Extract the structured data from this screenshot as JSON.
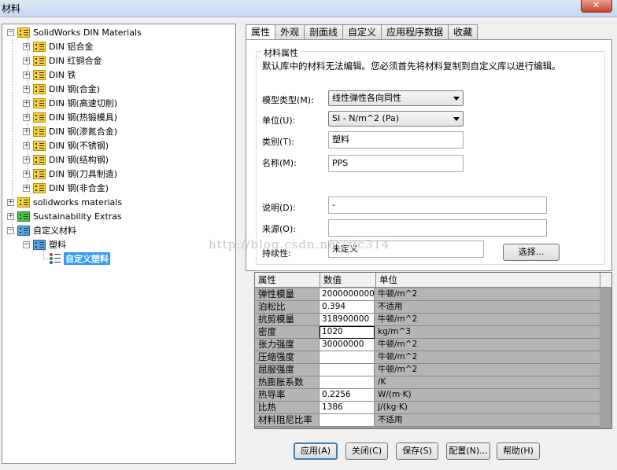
{
  "window": {
    "title": "材料"
  },
  "tree": {
    "libraries": [
      {
        "label": "SolidWorks DIN Materials",
        "expander": "−",
        "icon": "yellow-library-icon"
      },
      {
        "label": "solidworks materials",
        "expander": "+",
        "icon": "yellow-library-icon"
      },
      {
        "label": "Sustainability Extras",
        "expander": "+",
        "icon": "green-library-icon"
      },
      {
        "label": "自定义材料",
        "expander": "−",
        "icon": "blue-library-icon"
      }
    ],
    "din_categories": [
      "DIN 铝合金",
      "DIN 红铜合金",
      "DIN 铁",
      "DIN 钢(合金)",
      "DIN 钢(高速切削)",
      "DIN 钢(热锻模具)",
      "DIN 钢(渗氮合金)",
      "DIN 钢(不锈钢)",
      "DIN 钢(结构钢)",
      "DIN 钢(刀具制造)",
      "DIN 钢(非合金)"
    ],
    "custom_category": {
      "label": "塑料",
      "expander": "−"
    },
    "custom_material": {
      "label": "自定义塑料"
    }
  },
  "tabs": [
    "属性",
    "外观",
    "剖面线",
    "自定义",
    "应用程序数据",
    "收藏"
  ],
  "properties": {
    "group_title": "材料属性",
    "group_desc": "默认库中的材料无法编辑。您必须首先将材料复制到自定义库以进行编辑。",
    "model_type_label": "模型类型(M):",
    "model_type_value": "线性弹性各向同性",
    "units_label": "单位(U):",
    "units_value": "SI - N/m^2 (Pa)",
    "category_label": "类别(T):",
    "category_value": "塑料",
    "name_label": "名称(M):",
    "name_value": "PPS",
    "description_label": "说明(D):",
    "description_value": "-",
    "source_label": "来源(O):",
    "source_value": "",
    "sustainability_label": "持续性:",
    "sustainability_value": "未定义",
    "select_button": "选择..."
  },
  "watermark": "http://blog.csdn.net/zjc314",
  "grid": {
    "headers": [
      "属性",
      "数值",
      "单位"
    ],
    "rows": [
      {
        "property": "弹性模量",
        "value": "2000000000",
        "unit": "牛顿/m^2"
      },
      {
        "property": "泊松比",
        "value": "0.394",
        "unit": "不适用"
      },
      {
        "property": "抗剪模量",
        "value": "318900000",
        "unit": "牛顿/m^2"
      },
      {
        "property": "密度",
        "value": "1020",
        "unit": "kg/m^3"
      },
      {
        "property": "张力强度",
        "value": "30000000",
        "unit": "牛顿/m^2"
      },
      {
        "property": "压缩强度",
        "value": "",
        "unit": "牛顿/m^2"
      },
      {
        "property": "屈服强度",
        "value": "",
        "unit": "牛顿/m^2"
      },
      {
        "property": "热膨胀系数",
        "value": "",
        "unit": "/K"
      },
      {
        "property": "热导率",
        "value": "0.2256",
        "unit": "W/(m·K)"
      },
      {
        "property": "比热",
        "value": "1386",
        "unit": "J/(kg·K)"
      },
      {
        "property": "材料阻尼比率",
        "value": "",
        "unit": "不适用"
      }
    ]
  },
  "buttons": {
    "apply": "应用(A)",
    "close": "关闭(C)",
    "save": "保存(S)",
    "config": "配置(N)...",
    "help": "帮助(H)"
  }
}
